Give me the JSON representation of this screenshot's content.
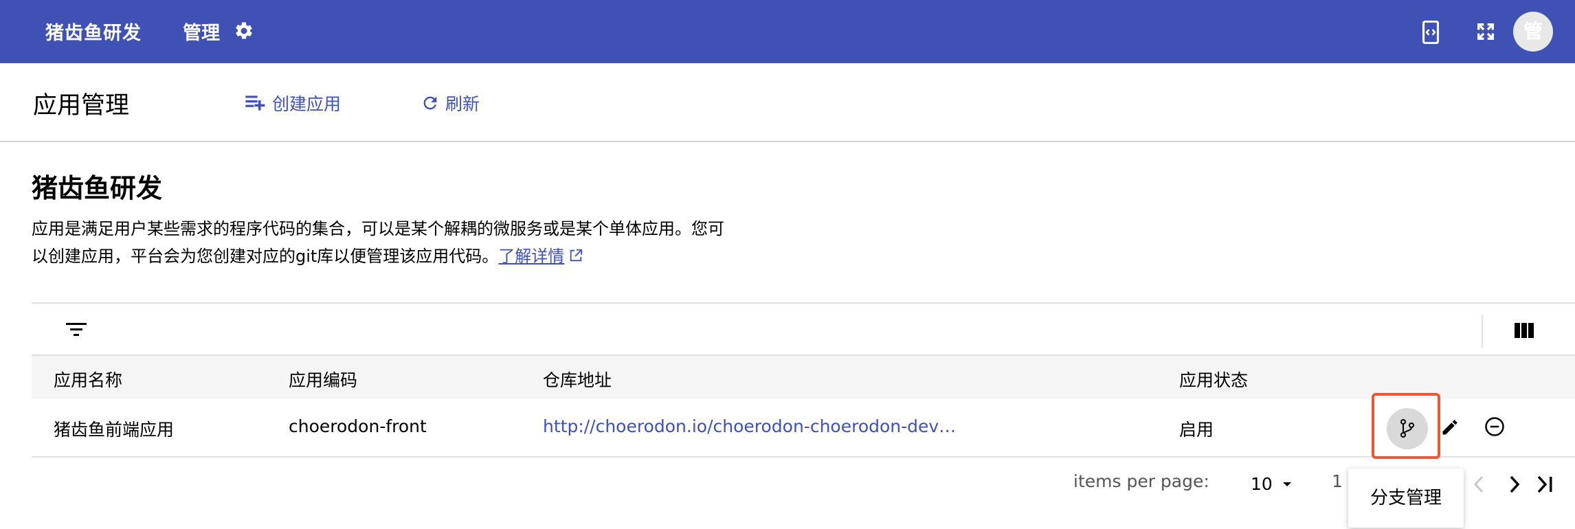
{
  "topbar": {
    "org_name": "猪齿鱼研发",
    "manage_label": "管理",
    "avatar_text": "管",
    "bg_color": "#3f51b5"
  },
  "header": {
    "title": "应用管理",
    "create_label": "创建应用",
    "refresh_label": "刷新"
  },
  "content": {
    "title": "猪齿鱼研发",
    "description": "应用是满足用户某些需求的程序代码的集合，可以是某个解耦的微服务或是某个单体应用。您可以创建应用，平台会为您创建对应的git库以便管理该应用代码。",
    "learn_more": "了解详情"
  },
  "table": {
    "columns": [
      "应用名称",
      "应用编码",
      "仓库地址",
      "应用状态"
    ],
    "rows": [
      {
        "name": "猪齿鱼前端应用",
        "code": "choerodon-front",
        "repo": "http://choerodon.io/choerodon-choerodon-dev…",
        "status": "启用"
      }
    ]
  },
  "pagination": {
    "items_per_page_label": "items per page:",
    "page_size": "10",
    "range": "1 -"
  },
  "tooltip": {
    "text": "分支管理"
  },
  "icons": [
    "gear-icon",
    "code-switch-icon",
    "fullscreen-icon",
    "playlist-add-icon",
    "refresh-icon",
    "external-link-icon",
    "filter-icon",
    "view-column-icon",
    "branch-icon",
    "edit-icon",
    "remove-circle-icon",
    "chevron-left-icon",
    "chevron-right-icon",
    "last-page-icon"
  ],
  "accent_color": "#3f51b5",
  "highlight_color": "#ee5733"
}
